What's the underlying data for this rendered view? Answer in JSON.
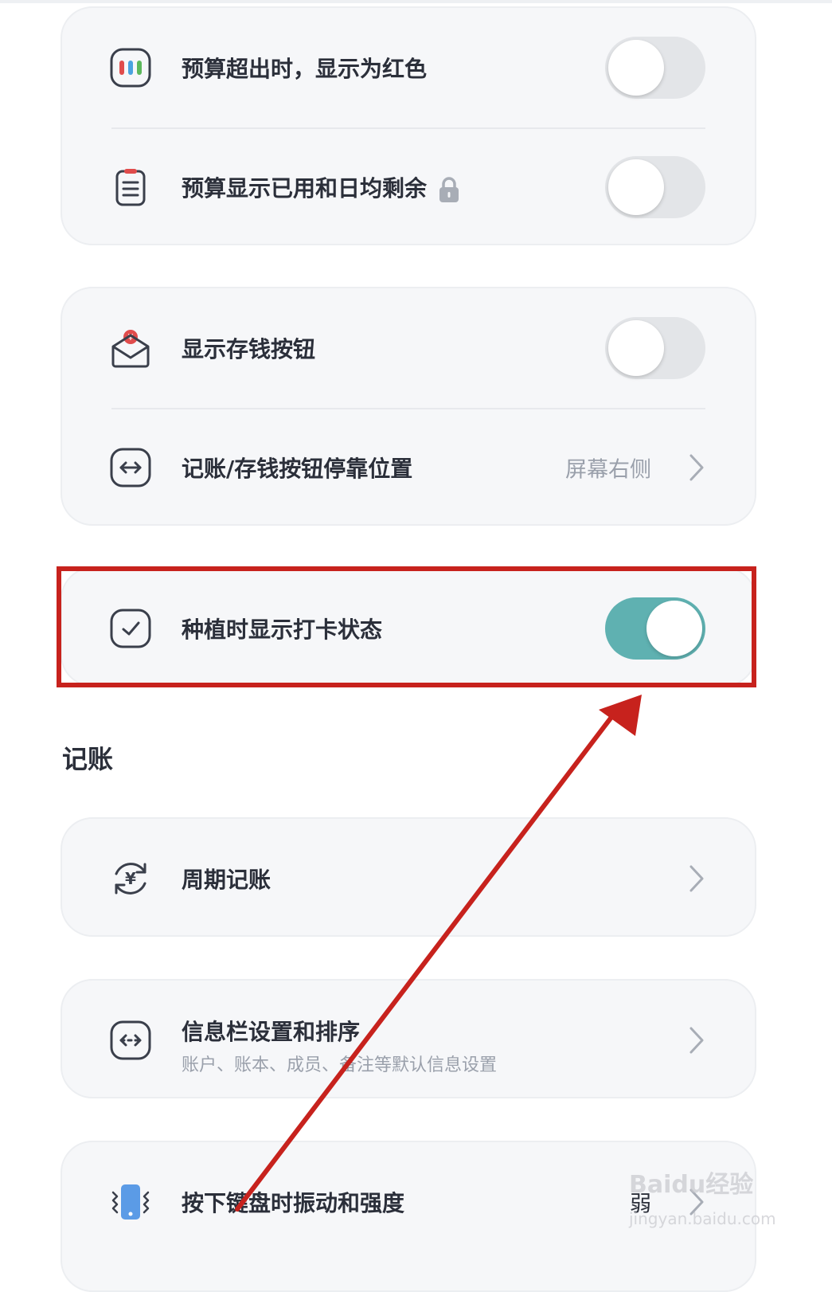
{
  "colors": {
    "accent": "#5fb1b1",
    "annotation": "#c7221d",
    "card": "#f6f7f9"
  },
  "group1": {
    "rows": [
      {
        "label": "预算超出时，显示为红色",
        "icon": "budget-bars-icon",
        "toggle": false
      },
      {
        "label": "预算显示已用和日均剩余",
        "icon": "clipboard-icon",
        "toggle": false,
        "locked": true
      }
    ]
  },
  "group2": {
    "rows": [
      {
        "label": "显示存钱按钮",
        "icon": "savings-envelope-icon",
        "toggle": false
      },
      {
        "label": "记账/存钱按钮停靠位置",
        "icon": "swap-arrows-icon",
        "value": "屏幕右侧"
      }
    ]
  },
  "group3": {
    "rows": [
      {
        "label": "种植时显示打卡状态",
        "icon": "checkbox-icon",
        "toggle": true
      }
    ]
  },
  "section": {
    "title": "记账"
  },
  "recurring": {
    "label": "周期记账",
    "icon": "recurring-yen-icon"
  },
  "infobar": {
    "label": "信息栏设置和排序",
    "sub": "账户、账本、成员、备注等默认信息设置",
    "icon": "swap-arrows-icon"
  },
  "vibration": {
    "label": "按下键盘时振动和强度",
    "value": "弱",
    "icon": "phone-vibrate-icon"
  },
  "watermark": {
    "brand": "Baidu经验",
    "site": "jingyan.baidu.com"
  }
}
